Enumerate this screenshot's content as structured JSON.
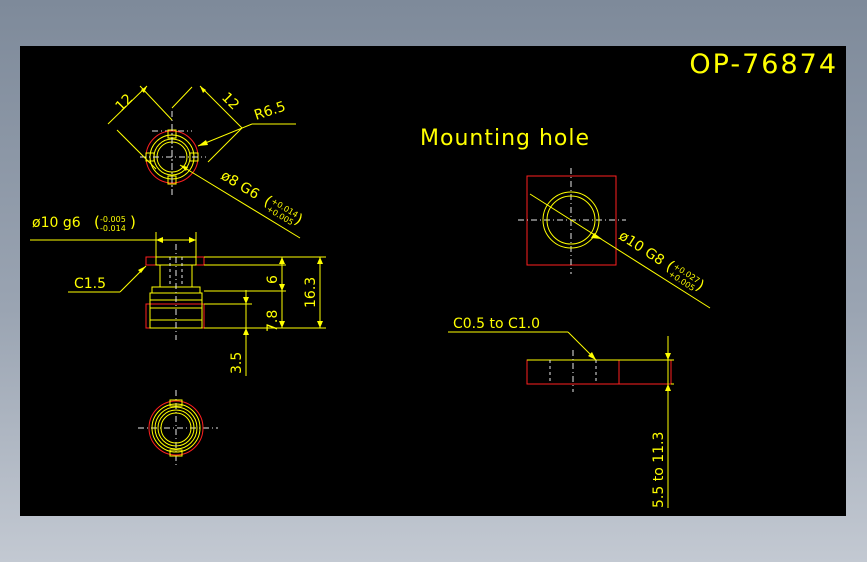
{
  "drawing": {
    "number": "OP-76874",
    "mounting_title": "Mounting hole"
  },
  "top_view": {
    "dim_left": "12",
    "dim_right": "12",
    "radius": "R6.5",
    "bore": "ø8 G6",
    "bore_tol_upper": "+0.014",
    "bore_tol_lower": "+0.005"
  },
  "side_view": {
    "shaft": "ø10 g6",
    "shaft_tol_upper": "-0.005",
    "shaft_tol_lower": "-0.014",
    "chamfer": "C1.5",
    "dim_6": "6",
    "dim_16_3": "16.3",
    "dim_7_8": "7.8",
    "dim_3_5": "3.5"
  },
  "mounting_hole": {
    "bore": "ø10 G8",
    "bore_tol_upper": "+0.027",
    "bore_tol_lower": "+0.005",
    "chamfer": "C0.5 to C1.0",
    "depth": "5.5 to 11.3"
  },
  "colors": {
    "background": "#000000",
    "dimension": "#ffff00",
    "outline": "#ff2020",
    "centerline": "#e8e8e8"
  }
}
